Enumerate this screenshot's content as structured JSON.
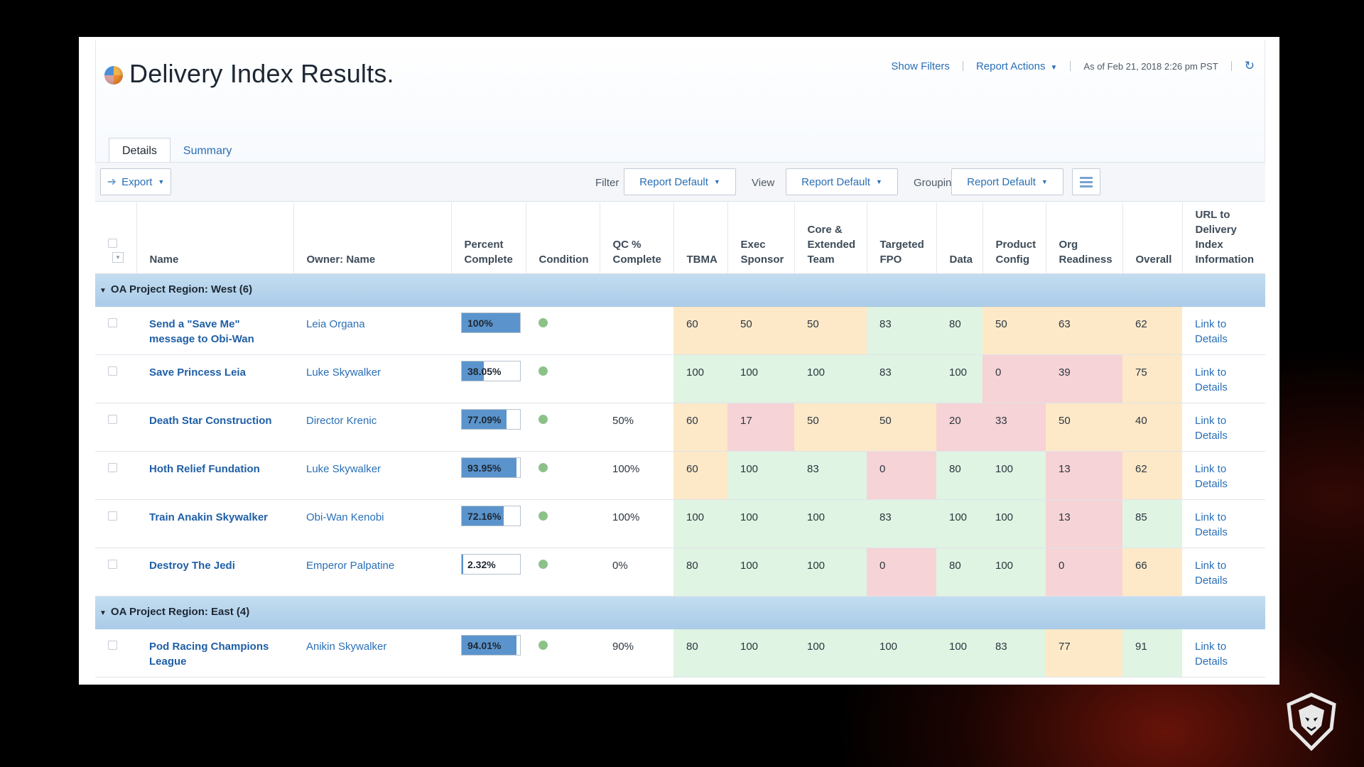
{
  "page": {
    "title": "Delivery Index Results.",
    "show_filters": "Show Filters",
    "report_actions": "Report Actions",
    "as_of": "As of Feb 21, 2018 2:26 pm PST",
    "refresh_icon": "refresh-icon"
  },
  "tabs": [
    {
      "label": "Details",
      "active": true
    },
    {
      "label": "Summary",
      "active": false
    }
  ],
  "toolbar": {
    "export_label": "Export",
    "filter_label": "Filter",
    "filter_value": "Report Default",
    "view_label": "View",
    "view_value": "Report Default",
    "grouping_label": "Grouping",
    "grouping_value": "Report Default"
  },
  "columns": [
    "Name",
    "Owner: Name",
    "Percent Complete",
    "Condition",
    "QC % Complete",
    "TBMA",
    "Exec Sponsor",
    "Core & Extended Team",
    "Targeted FPO",
    "Data",
    "Product Config",
    "Org Readiness",
    "Overall",
    "URL to Delivery Index Information"
  ],
  "groups": [
    {
      "label": "OA Project Region: West (6)",
      "rows": [
        {
          "name": "Send a \"Save Me\" message to Obi-Wan",
          "owner": "Leia Organa",
          "pct_text": "100%",
          "pct": 1.0,
          "qc": "",
          "scores": [
            "60",
            "50",
            "50",
            "83",
            "80",
            "50",
            "63",
            "62"
          ],
          "link": "Link to Details"
        },
        {
          "name": "Save Princess Leia",
          "owner": "Luke Skywalker",
          "pct_text": "38.05%",
          "pct": 0.3805,
          "qc": "",
          "scores": [
            "100",
            "100",
            "100",
            "83",
            "100",
            "0",
            "39",
            "75"
          ],
          "link": "Link to Details"
        },
        {
          "name": "Death Star Construction",
          "owner": "Director Krenic",
          "pct_text": "77.09%",
          "pct": 0.7709,
          "qc": "50%",
          "scores": [
            "60",
            "17",
            "50",
            "50",
            "20",
            "33",
            "50",
            "40"
          ],
          "link": "Link to Details"
        },
        {
          "name": "Hoth Relief Fundation",
          "owner": "Luke Skywalker",
          "pct_text": "93.95%",
          "pct": 0.9395,
          "qc": "100%",
          "scores": [
            "60",
            "100",
            "83",
            "0",
            "80",
            "100",
            "13",
            "62"
          ],
          "link": "Link to Details"
        },
        {
          "name": "Train Anakin Skywalker",
          "owner": "Obi-Wan Kenobi",
          "pct_text": "72.16%",
          "pct": 0.7216,
          "qc": "100%",
          "scores": [
            "100",
            "100",
            "100",
            "83",
            "100",
            "100",
            "13",
            "85"
          ],
          "link": "Link to Details"
        },
        {
          "name": "Destroy The Jedi",
          "owner": "Emperor Palpatine",
          "pct_text": "2.32%",
          "pct": 0.0232,
          "qc": "0%",
          "scores": [
            "80",
            "100",
            "100",
            "0",
            "80",
            "100",
            "0",
            "66"
          ],
          "link": "Link to Details"
        }
      ]
    },
    {
      "label": "OA Project Region: East (4)",
      "rows": [
        {
          "name": "Pod Racing Champions League",
          "owner": "Anikin Skywalker",
          "pct_text": "94.01%",
          "pct": 0.9401,
          "qc": "90%",
          "scores": [
            "80",
            "100",
            "100",
            "100",
            "100",
            "83",
            "77",
            "91"
          ],
          "link": "Link to Details"
        }
      ]
    }
  ],
  "colors": {
    "score_green": "#dff4e2",
    "score_yellow": "#fde9c8",
    "score_red": "#f6d3d6",
    "condition_green": "#8cc28a",
    "group_header": "#b6d3ec",
    "progress_fill": "#5b94cc"
  }
}
